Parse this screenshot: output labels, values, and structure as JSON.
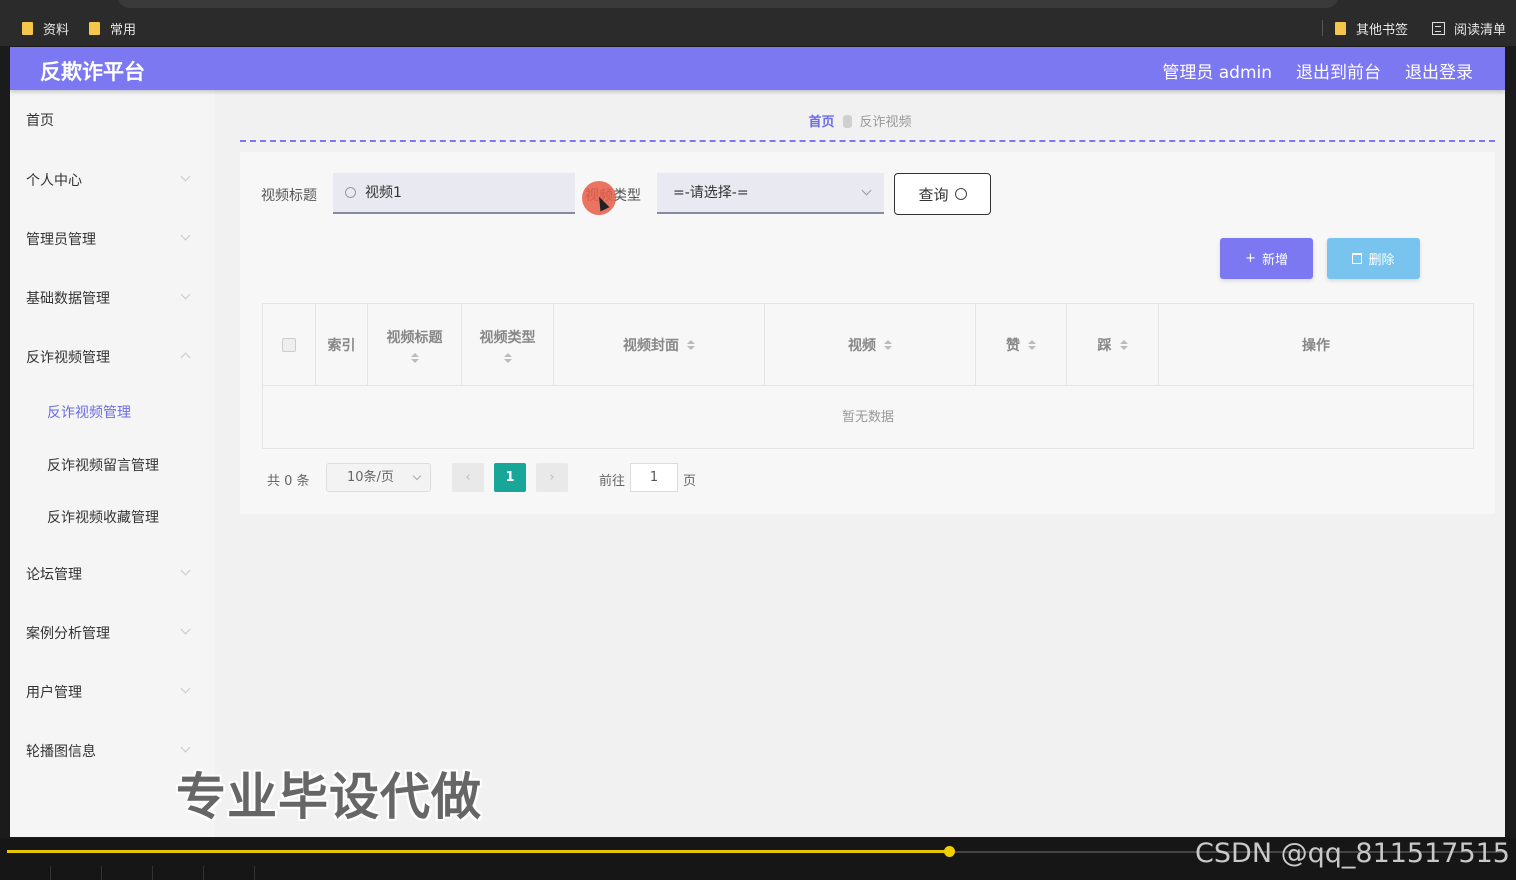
{
  "browser": {
    "bookmarks_left": [
      "资料",
      "常用"
    ],
    "bookmarks_right": [
      "其他书签",
      "阅读清单"
    ]
  },
  "header": {
    "brand": "反欺诈平台",
    "admin": "管理员 admin",
    "to_front": "退出到前台",
    "logout": "退出登录"
  },
  "sidebar": {
    "items": [
      {
        "label": "首页"
      },
      {
        "label": "个人中心"
      },
      {
        "label": "管理员管理"
      },
      {
        "label": "基础数据管理"
      },
      {
        "label": "反诈视频管理"
      },
      {
        "label": "反诈视频管理"
      },
      {
        "label": "反诈视频留言管理"
      },
      {
        "label": "反诈视频收藏管理"
      },
      {
        "label": "论坛管理"
      },
      {
        "label": "案例分析管理"
      },
      {
        "label": "用户管理"
      },
      {
        "label": "轮播图信息"
      }
    ]
  },
  "breadcrumb": {
    "home": "首页",
    "current": "反诈视频"
  },
  "search": {
    "title_label": "视频标题",
    "title_value": "视频1",
    "type_label": "视频类型",
    "type_value": "=-请选择-=",
    "query_label": "查询"
  },
  "actions": {
    "add": "新增",
    "delete": "删除"
  },
  "table": {
    "columns": [
      "索引",
      "视频标题",
      "视频类型",
      "视频封面",
      "视频",
      "赞",
      "踩",
      "操作"
    ],
    "empty": "暂无数据"
  },
  "pagination": {
    "total": "共 0 条",
    "page_size": "10条/页",
    "current_page": "1",
    "goto_label": "前往",
    "goto_value": "1",
    "page_suffix": "页",
    "prev": "‹",
    "next": "›"
  },
  "overlay": {
    "watermark": "专业毕设代做",
    "credit": "CSDN @qq_811517515"
  },
  "player": {
    "progress": 0.628
  },
  "colors": {
    "accent": "#7b78f2",
    "page_active": "#17a697",
    "delete": "#78c4ef"
  }
}
